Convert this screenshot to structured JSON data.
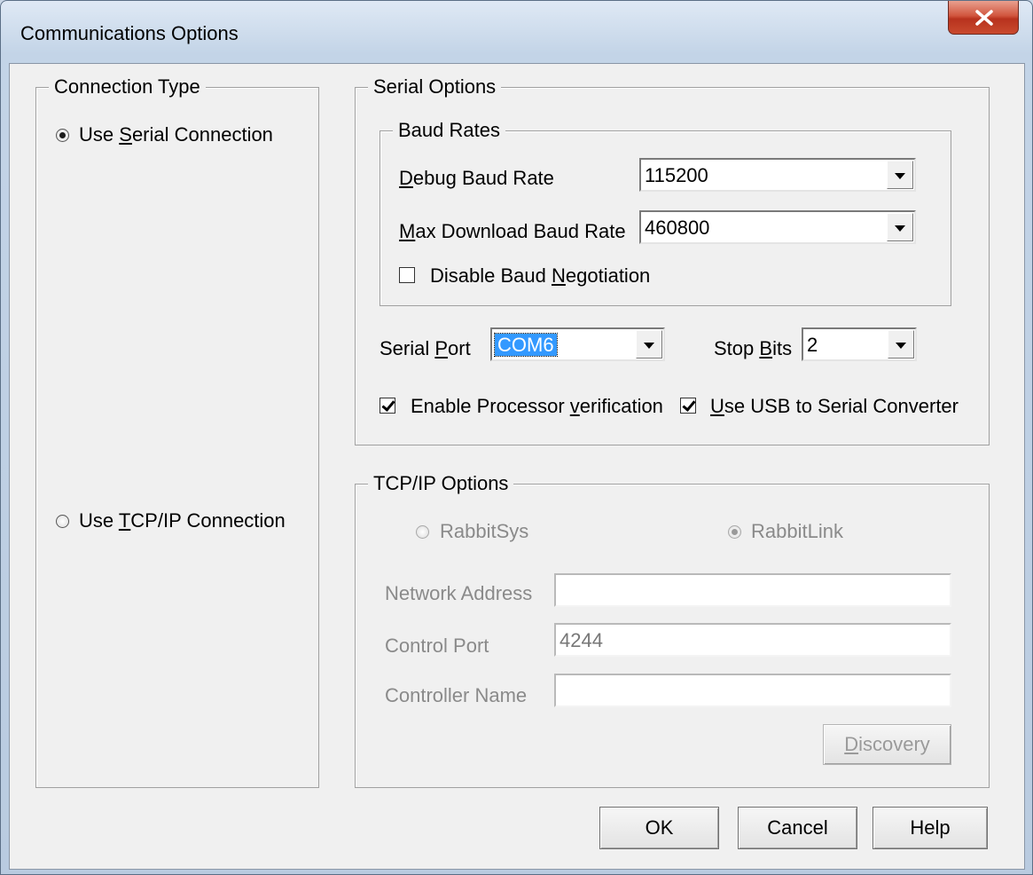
{
  "window": {
    "title": "Communications Options"
  },
  "connection_type": {
    "legend": "Connection Type",
    "serial": {
      "pre": "Use ",
      "ul": "S",
      "post": "erial Connection",
      "checked": true
    },
    "tcpip": {
      "pre": "Use ",
      "ul": "T",
      "post": "CP/IP Connection",
      "checked": false
    }
  },
  "serial_options": {
    "legend": "Serial Options",
    "baud_rates": {
      "legend": "Baud Rates",
      "debug": {
        "ul": "D",
        "post": "ebug Baud Rate",
        "value": "115200"
      },
      "max_download": {
        "ul": "M",
        "post": "ax Download Baud Rate",
        "value": "460800"
      },
      "disable_negotiation": {
        "pre": "Disable Baud ",
        "ul": "N",
        "post": "egotiation",
        "checked": false
      }
    },
    "serial_port": {
      "pre": "Serial ",
      "ul": "P",
      "post": "ort",
      "value": "COM6"
    },
    "stop_bits": {
      "pre": "Stop ",
      "ul": "B",
      "post": "its",
      "value": "2"
    },
    "enable_verification": {
      "pre": "Enable Processor ",
      "ul": "v",
      "post": "erification",
      "checked": true
    },
    "use_usb": {
      "ul": "U",
      "post": "se USB to Serial Converter",
      "checked": true
    }
  },
  "tcpip_options": {
    "legend": "TCP/IP Options",
    "rabbitsys": {
      "label": "RabbitSys",
      "checked": false
    },
    "rabbitlink": {
      "label": "RabbitLink",
      "checked": true
    },
    "network_address": {
      "label": "Network Address",
      "value": ""
    },
    "control_port": {
      "label": "Control Port",
      "value": "4244"
    },
    "controller_name": {
      "label": "Controller Name",
      "value": ""
    },
    "discovery": {
      "ul": "D",
      "post": "iscovery"
    }
  },
  "buttons": {
    "ok": "OK",
    "cancel": "Cancel",
    "help": "Help"
  }
}
